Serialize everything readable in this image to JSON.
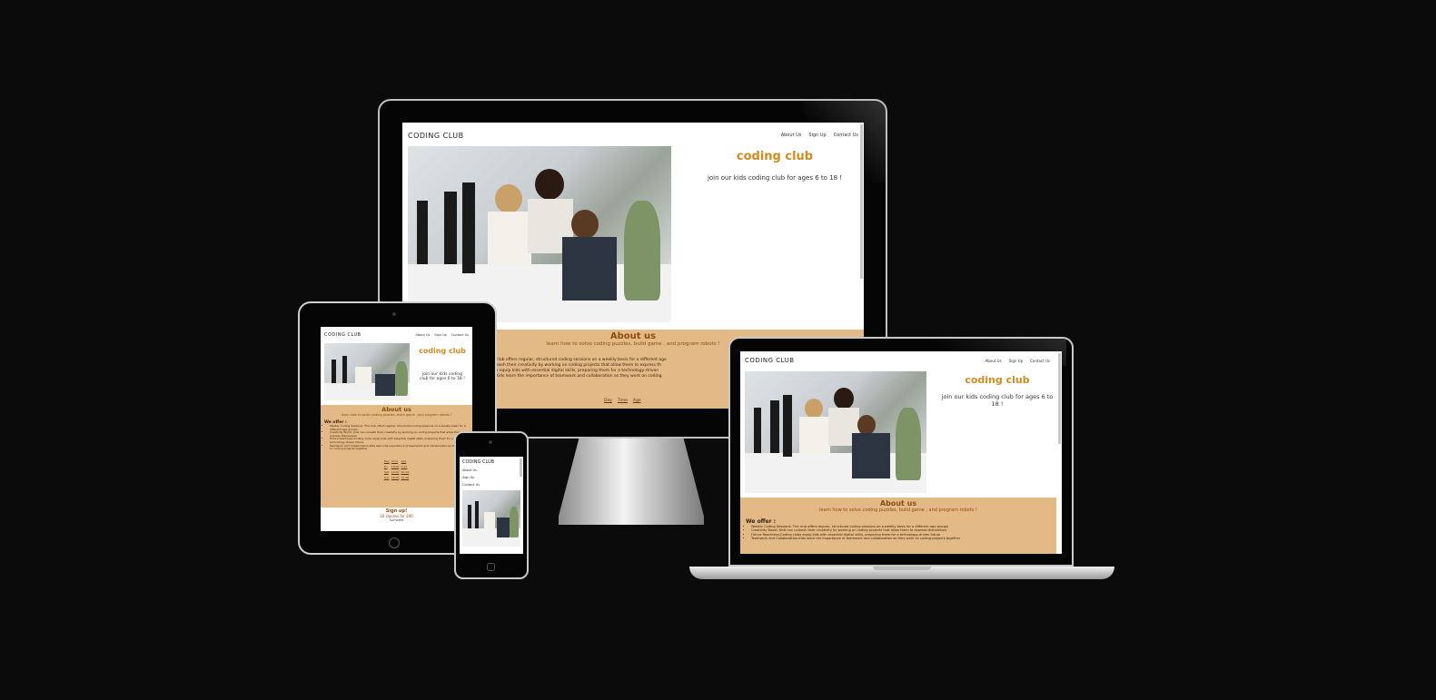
{
  "site": {
    "logo": "CODING CLUB",
    "nav": [
      "About Us",
      "Sign Up",
      "Contact Us"
    ],
    "hero_title": "coding club",
    "hero_sub": "join our kids coding club for ages 6 to 18 !",
    "about_title": "About us",
    "about_sub": "learn how to solve coding puzzles, build game , and program robots !",
    "offer_title": "We offer :",
    "offers": [
      "Weekly Coding Sessions: The club offers regular, structured coding sessions on a weekly basis for a different age groups",
      "Creativity Boost: Kids can unleash their creativity by working on coding projects that allow them to express themselves",
      "Future Readiness:Coding clubs equip kids with essential digital skills, preparing them for a technology-driven future",
      "Teamwork and Collaboration:Kids learn the importance of teamwork and collaboration as they work on coding projects together"
    ],
    "about_paragraph": [
      "club offers regular, structured coding sessions on a weekly basis for a different age",
      "eash their creativity by working on coding projects that allow them to express th",
      "s equip kids with essential digital skills, preparing them for a technology-driven",
      "Kids learn the importance of teamwork and collaboration as they work on coding"
    ],
    "table_headers": [
      "Day",
      "Time",
      "Age"
    ],
    "table_rows": [
      [
        "Fri",
        "16:00",
        "6-10"
      ],
      [
        "Sat",
        "14:00",
        "10-14"
      ],
      [
        "Sun",
        "16:00",
        "14-18"
      ]
    ],
    "signup_title": "Sign up!",
    "signup_sub": "10 classes for £40",
    "signup_name": "Surname"
  },
  "colors": {
    "background": "#0b0b0b",
    "accent_orange": "#d68a1e",
    "about_bg": "#e3b985"
  }
}
